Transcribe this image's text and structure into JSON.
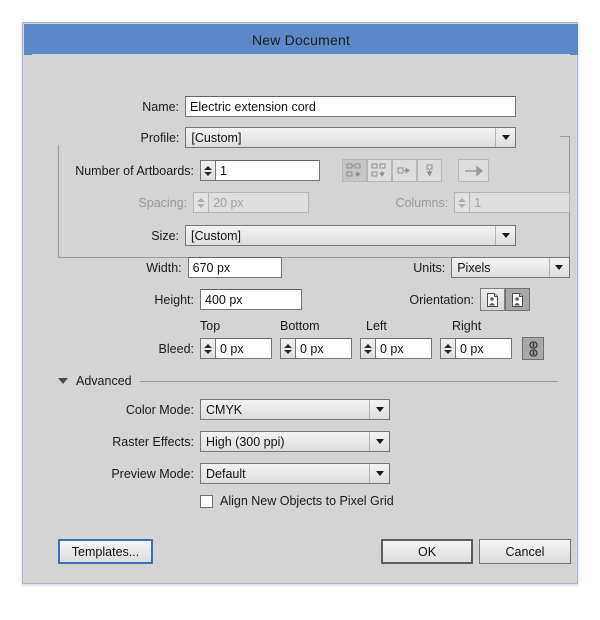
{
  "window": {
    "title": "New Document",
    "titlebar_color": "#5b89c8",
    "body_color": "#d4d4d4"
  },
  "fields": {
    "name": {
      "label": "Name:",
      "value": "Electric extension cord"
    },
    "profile": {
      "label": "Profile:",
      "value": "[Custom]"
    },
    "artboards": {
      "label": "Number of Artboards:",
      "value": "1"
    },
    "spacing": {
      "label": "Spacing:",
      "value": "20 px"
    },
    "columns": {
      "label": "Columns:",
      "value": "1"
    },
    "size": {
      "label": "Size:",
      "value": "[Custom]"
    },
    "width": {
      "label": "Width:",
      "value": "670 px"
    },
    "units": {
      "label": "Units:",
      "value": "Pixels"
    },
    "height": {
      "label": "Height:",
      "value": "400 px"
    },
    "orientation": {
      "label": "Orientation:"
    }
  },
  "artboard_layout_icons": [
    "grid-by-row-icon",
    "grid-by-column-icon",
    "arrange-by-row-icon",
    "arrange-by-column-icon"
  ],
  "artboard_direction_icon": "right-to-left-arrow-icon",
  "orientation_icons": [
    "portrait-icon",
    "landscape-icon"
  ],
  "orientation_selected": "landscape-icon",
  "bleed": {
    "label": "Bleed:",
    "headers": [
      "Top",
      "Bottom",
      "Left",
      "Right"
    ],
    "values": [
      "0 px",
      "0 px",
      "0 px",
      "0 px"
    ],
    "link_icon": "chain-link-icon"
  },
  "advanced": {
    "label": "Advanced",
    "disclosure_icon": "triangle-down-icon",
    "color_mode": {
      "label": "Color Mode:",
      "value": "CMYK"
    },
    "raster_effects": {
      "label": "Raster Effects:",
      "value": "High (300 ppi)"
    },
    "preview_mode": {
      "label": "Preview Mode:",
      "value": "Default"
    },
    "align_pixel_grid": {
      "label": "Align New Objects to Pixel Grid",
      "checked": false
    }
  },
  "footer": {
    "templates": "Templates...",
    "ok": "OK",
    "cancel": "Cancel"
  }
}
